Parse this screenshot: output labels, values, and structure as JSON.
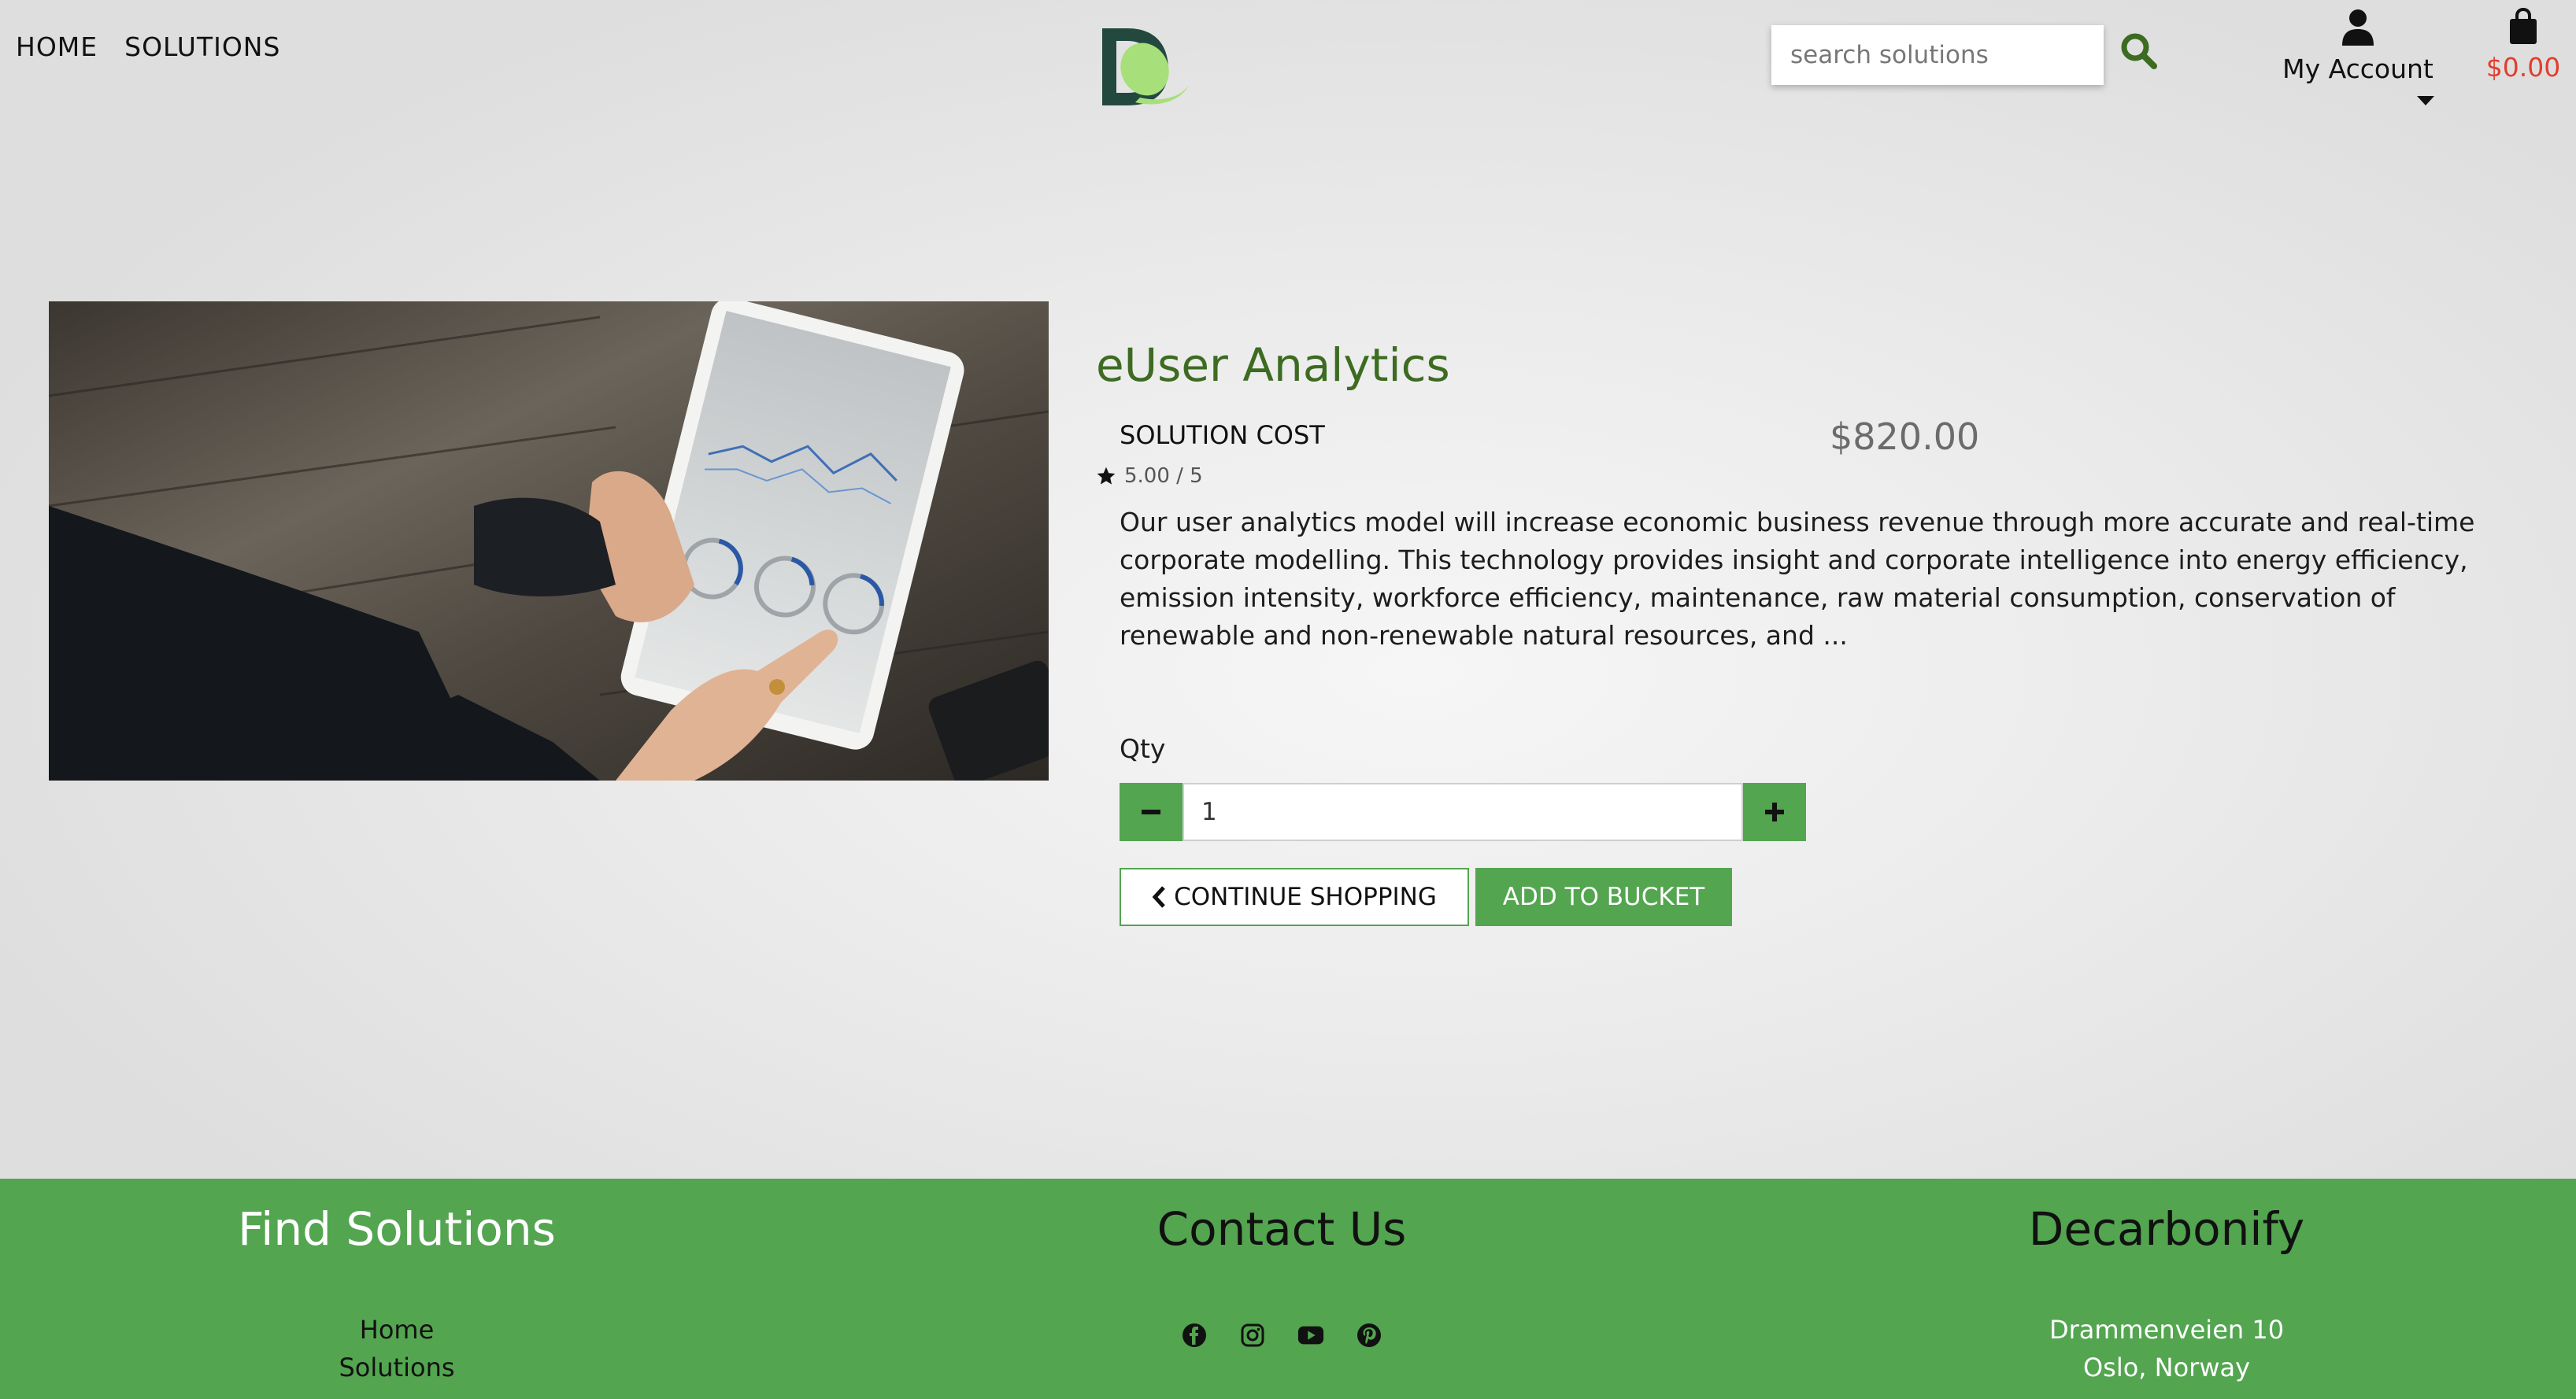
{
  "nav": {
    "items": [
      "HOME",
      "SOLUTIONS"
    ]
  },
  "search": {
    "placeholder": "search solutions"
  },
  "account": {
    "label": "My Account"
  },
  "cart": {
    "total": "$0.00"
  },
  "product": {
    "title": "eUser Analytics",
    "cost_label": "SOLUTION COST",
    "price": "$820.00",
    "rating": "5.00 / 5",
    "description": "Our user analytics model will increase economic business revenue through more accurate and real-time corporate modelling. This technology provides insight and corporate intelligence into energy efficiency, emission intensity, workforce efficiency, maintenance, raw material consumption, conservation of renewable and non-renewable natural resources, and ...",
    "qty_label": "Qty",
    "qty_value": "1",
    "continue_label": "CONTINUE SHOPPING",
    "add_label": "ADD TO BUCKET"
  },
  "footer": {
    "col1": {
      "title": "Find Solutions",
      "links": [
        "Home",
        "Solutions"
      ]
    },
    "col2": {
      "title": "Contact Us",
      "icons": [
        "facebook-icon",
        "instagram-icon",
        "youtube-icon",
        "pinterest-icon"
      ]
    },
    "col3": {
      "title": "Decarbonify",
      "address": [
        "Drammenveien 10",
        "Oslo, Norway"
      ]
    }
  },
  "colors": {
    "brand_green": "#53a550",
    "title_green": "#3d6b21",
    "cart_red": "#e03e2d"
  }
}
